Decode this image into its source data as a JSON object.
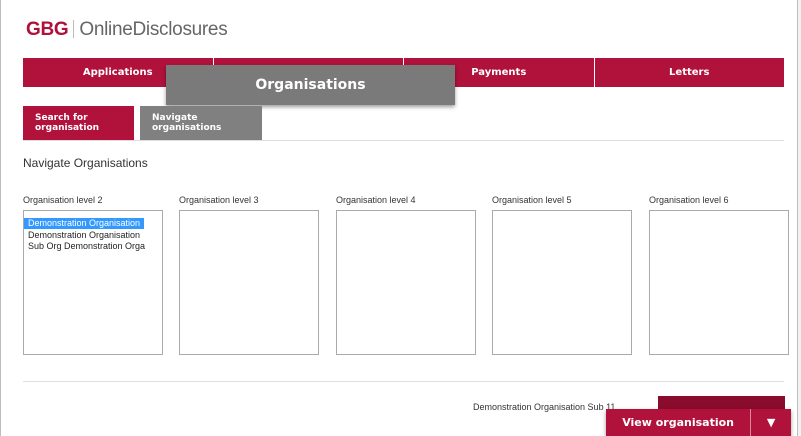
{
  "brand": {
    "company": "GBG",
    "product": "OnlineDisclosures"
  },
  "main_nav": [
    {
      "label": "Applications"
    },
    {
      "label": "Organisations"
    },
    {
      "label": "Payments"
    },
    {
      "label": "Letters"
    }
  ],
  "popup_label": "Organisations",
  "sub_tabs": [
    {
      "label": "Search for organisation"
    },
    {
      "label": "Navigate organisations"
    }
  ],
  "section_title": "Navigate Organisations",
  "levels": [
    {
      "label": "Organisation level 2",
      "options": [
        "Demonstration Organisation",
        "Demonstration Organisation",
        "Sub Org Demonstration Orga"
      ],
      "selected_index": 0
    },
    {
      "label": "Organisation level 3",
      "options": []
    },
    {
      "label": "Organisation level 4",
      "options": []
    },
    {
      "label": "Organisation level 5",
      "options": []
    },
    {
      "label": "Organisation level 6",
      "options": []
    }
  ],
  "selected_org_text": "Demonstration Organisation Sub 11",
  "view_button": {
    "label": "View organisation",
    "caret_icon": "caret-down-icon",
    "caret_glyph": "▼"
  },
  "colors": {
    "brand": "#b0123b",
    "grey_tab": "#808080",
    "selection": "#3399ff"
  }
}
